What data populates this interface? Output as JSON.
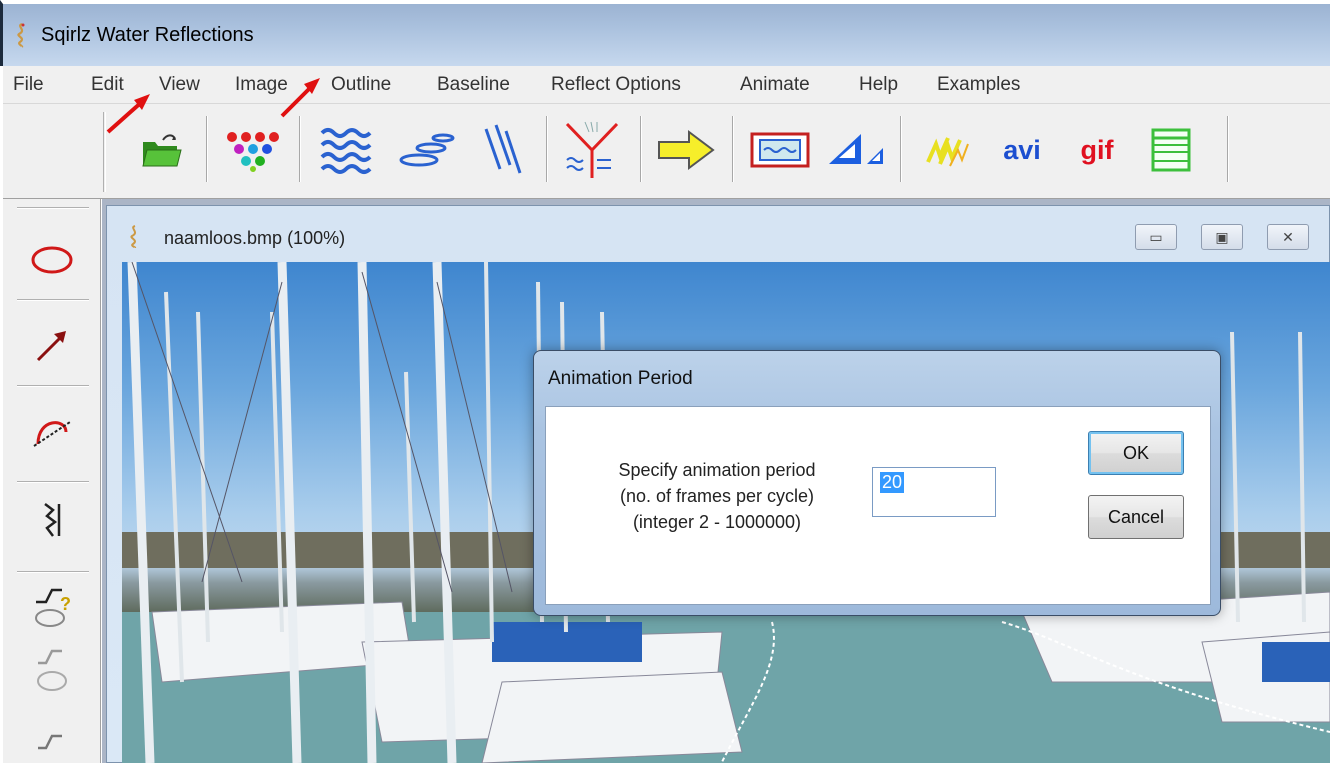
{
  "app": {
    "title": "Sqirlz Water Reflections"
  },
  "menu": [
    "File",
    "Edit",
    "View",
    "Image",
    "Outline",
    "Baseline",
    "Reflect Options",
    "Animate",
    "Help",
    "Examples"
  ],
  "toolbar": {
    "avi_label": "avi",
    "gif_label": "gif"
  },
  "document": {
    "title": "naamloos.bmp  (100%)"
  },
  "dialog": {
    "title": "Animation Period",
    "prompt_line1": "Specify animation period",
    "prompt_line2": "(no. of frames per cycle)",
    "prompt_line3": "(integer 2 - 1000000)",
    "value": "20",
    "ok_label": "OK",
    "cancel_label": "Cancel"
  },
  "colors": {
    "accent_red": "#e01010",
    "accent_blue": "#2a62d0",
    "selection": "#3399ff"
  }
}
